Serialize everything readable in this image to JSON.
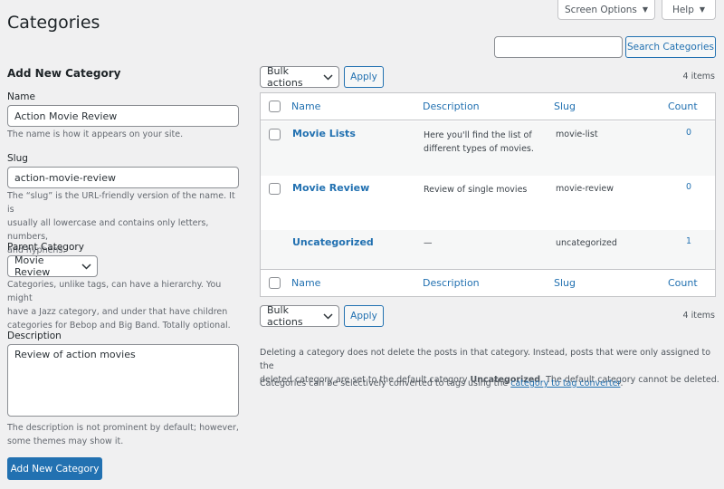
{
  "page": {
    "title": "Categories"
  },
  "top_tabs": {
    "screen_options": "Screen Options",
    "help": "Help"
  },
  "search": {
    "placeholder": "",
    "value": "",
    "button": "Search Categories"
  },
  "form": {
    "heading": "Add New Category",
    "name_label": "Name",
    "name_value": "Action Movie Review",
    "name_help": "The name is how it appears on your site.",
    "slug_label": "Slug",
    "slug_value": "action-movie-review",
    "slug_help_1": "The “slug” is the URL-friendly version of the name. It is",
    "slug_help_2": "usually all lowercase and contains only letters, numbers,",
    "slug_help_3": "and hyphens.",
    "parent_label": "Parent Category",
    "parent_value": "Movie Review",
    "parent_help_1": "Categories, unlike tags, can have a hierarchy. You might",
    "parent_help_2": "have a Jazz category, and under that have children",
    "parent_help_3": "categories for Bebop and Big Band. Totally optional.",
    "desc_label": "Description",
    "desc_value": "Review of action movies",
    "desc_help_1": "The description is not prominent by default; however,",
    "desc_help_2": "some themes may show it.",
    "submit": "Add New Category"
  },
  "bulk_top": {
    "select": "Bulk actions",
    "apply": "Apply",
    "items": "4 items"
  },
  "bulk_bottom": {
    "select": "Bulk actions",
    "apply": "Apply",
    "items": "4 items"
  },
  "table": {
    "columns": {
      "name": "Name",
      "description": "Description",
      "slug": "Slug",
      "count": "Count"
    },
    "rows": [
      {
        "name": "Movie Lists",
        "desc_1": "Here you'll find the list of",
        "desc_2": "different types of movies.",
        "slug": "movie-list",
        "count": "0"
      },
      {
        "name": "Movie Review",
        "desc_1": "Review of single movies",
        "desc_2": "",
        "slug": "movie-review",
        "count": "0"
      },
      {
        "name": "Uncategorized",
        "desc_1": "—",
        "desc_2": "",
        "slug": "uncategorized",
        "count": "1"
      }
    ]
  },
  "notes": {
    "delete_1": "Deleting a category does not delete the posts in that category. Instead, posts that were only assigned to the",
    "delete_2a": "deleted category are set to the default category ",
    "delete_2b": "Uncategorized",
    "delete_2c": ". The default category cannot be deleted.",
    "convert_a": "Categories can be selectively converted to tags using the ",
    "convert_link": "category to tag converter",
    "convert_b": "."
  },
  "colors": {
    "accent": "#2271b1",
    "background": "#f0f0f1"
  },
  "icons": {
    "dropdown": "chevron-down-icon",
    "tab_toggle": "triangle-down-icon"
  }
}
